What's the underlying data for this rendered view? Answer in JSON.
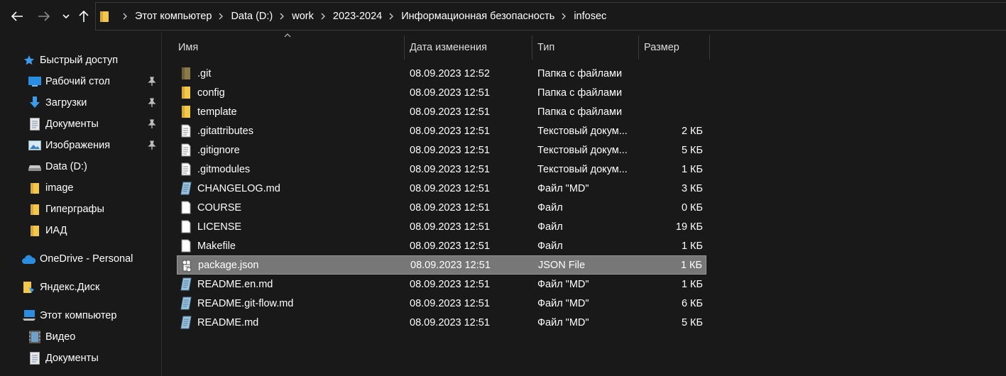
{
  "nav": {
    "back_icon": "arrow-left-icon",
    "forward_icon": "arrow-right-icon",
    "recent_icon": "chevron-down-icon",
    "up_icon": "arrow-up-icon"
  },
  "breadcrumb": [
    "Этот компьютер",
    "Data (D:)",
    "work",
    "2023-2024",
    "Информационная безопасность",
    "infosec"
  ],
  "sidebar": {
    "items": [
      {
        "label": "Быстрый доступ",
        "icon": "star-icon",
        "pinned": false
      },
      {
        "label": "Рабочий стол",
        "icon": "desktop-icon",
        "pinned": true
      },
      {
        "label": "Загрузки",
        "icon": "download-icon",
        "pinned": true
      },
      {
        "label": "Документы",
        "icon": "document-icon",
        "pinned": true
      },
      {
        "label": "Изображения",
        "icon": "pictures-icon",
        "pinned": true
      },
      {
        "label": "Data (D:)",
        "icon": "drive-icon",
        "pinned": false
      },
      {
        "label": "image",
        "icon": "folder-icon",
        "pinned": false
      },
      {
        "label": "Гиперграфы",
        "icon": "folder-icon",
        "pinned": false
      },
      {
        "label": "ИАД",
        "icon": "folder-icon",
        "pinned": false
      },
      {
        "label": "OneDrive - Personal",
        "icon": "cloud-icon",
        "pinned": false
      },
      {
        "label": "Яндекс.Диск",
        "icon": "yandex-disk-icon",
        "pinned": false
      },
      {
        "label": "Этот компьютер",
        "icon": "computer-icon",
        "pinned": false
      },
      {
        "label": "Видео",
        "icon": "video-icon",
        "pinned": false
      },
      {
        "label": "Документы",
        "icon": "document-icon",
        "pinned": false
      }
    ]
  },
  "columns": {
    "name": "Имя",
    "date": "Дата изменения",
    "type": "Тип",
    "size": "Размер"
  },
  "files": [
    {
      "name": ".git",
      "date": "08.09.2023 12:52",
      "type": "Папка с файлами",
      "size": "",
      "icon": "folder-icon"
    },
    {
      "name": "config",
      "date": "08.09.2023 12:51",
      "type": "Папка с файлами",
      "size": "",
      "icon": "folder-icon"
    },
    {
      "name": "template",
      "date": "08.09.2023 12:51",
      "type": "Папка с файлами",
      "size": "",
      "icon": "folder-icon"
    },
    {
      "name": ".gitattributes",
      "date": "08.09.2023 12:51",
      "type": "Текстовый докум...",
      "size": "2 КБ",
      "icon": "text-file-icon"
    },
    {
      "name": ".gitignore",
      "date": "08.09.2023 12:51",
      "type": "Текстовый докум...",
      "size": "5 КБ",
      "icon": "text-file-icon"
    },
    {
      "name": ".gitmodules",
      "date": "08.09.2023 12:51",
      "type": "Текстовый докум...",
      "size": "1 КБ",
      "icon": "text-file-icon"
    },
    {
      "name": "CHANGELOG.md",
      "date": "08.09.2023 12:51",
      "type": "Файл \"MD\"",
      "size": "3 КБ",
      "icon": "markdown-file-icon"
    },
    {
      "name": "COURSE",
      "date": "08.09.2023 12:51",
      "type": "Файл",
      "size": "0 КБ",
      "icon": "blank-file-icon"
    },
    {
      "name": "LICENSE",
      "date": "08.09.2023 12:51",
      "type": "Файл",
      "size": "19 КБ",
      "icon": "blank-file-icon"
    },
    {
      "name": "Makefile",
      "date": "08.09.2023 12:51",
      "type": "Файл",
      "size": "1 КБ",
      "icon": "blank-file-icon"
    },
    {
      "name": "package.json",
      "date": "08.09.2023 12:51",
      "type": "JSON File",
      "size": "1 КБ",
      "icon": "json-file-icon",
      "selected": true
    },
    {
      "name": "README.en.md",
      "date": "08.09.2023 12:51",
      "type": "Файл \"MD\"",
      "size": "1 КБ",
      "icon": "markdown-file-icon"
    },
    {
      "name": "README.git-flow.md",
      "date": "08.09.2023 12:51",
      "type": "Файл \"MD\"",
      "size": "6 КБ",
      "icon": "markdown-file-icon"
    },
    {
      "name": "README.md",
      "date": "08.09.2023 12:51",
      "type": "Файл \"MD\"",
      "size": "5 КБ",
      "icon": "markdown-file-icon"
    }
  ],
  "colors": {
    "background": "#191919",
    "selection": "#777777",
    "folder": "#f3c74a",
    "git_folder": "#8a7a4a",
    "accent_blue": "#3d9be9"
  }
}
